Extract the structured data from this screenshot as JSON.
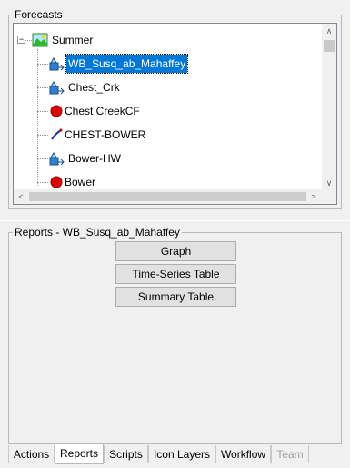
{
  "forecasts": {
    "title": "Forecasts",
    "root": {
      "label": "Summer",
      "expander": "−"
    },
    "items": [
      {
        "label": "WB_Susq_ab_Mahaffey",
        "icon": "reservoir-icon",
        "selected": true
      },
      {
        "label": "Chest_Crk",
        "icon": "reservoir-icon"
      },
      {
        "label": "Chest CreekCF",
        "icon": "red-circle-icon"
      },
      {
        "label": "CHEST-BOWER",
        "icon": "reach-line-icon"
      },
      {
        "label": "Bower-HW",
        "icon": "reservoir-icon"
      },
      {
        "label": "Bower",
        "icon": "red-circle-icon"
      }
    ]
  },
  "reports": {
    "title": "Reports - WB_Susq_ab_Mahaffey",
    "buttons": {
      "graph": "Graph",
      "timeseries": "Time-Series Table",
      "summary": "Summary Table"
    }
  },
  "tabs": {
    "actions": "Actions",
    "reports": "Reports",
    "scripts": "Scripts",
    "icon_layers": "Icon Layers",
    "workflow": "Workflow",
    "team": "Team"
  },
  "scroll_glyphs": {
    "up": "∧",
    "down": "∨",
    "left": "<",
    "right": ">"
  },
  "colors": {
    "selection": "#0078d7",
    "red_node": "#e00000",
    "reservoir": "#2e7fd0"
  }
}
